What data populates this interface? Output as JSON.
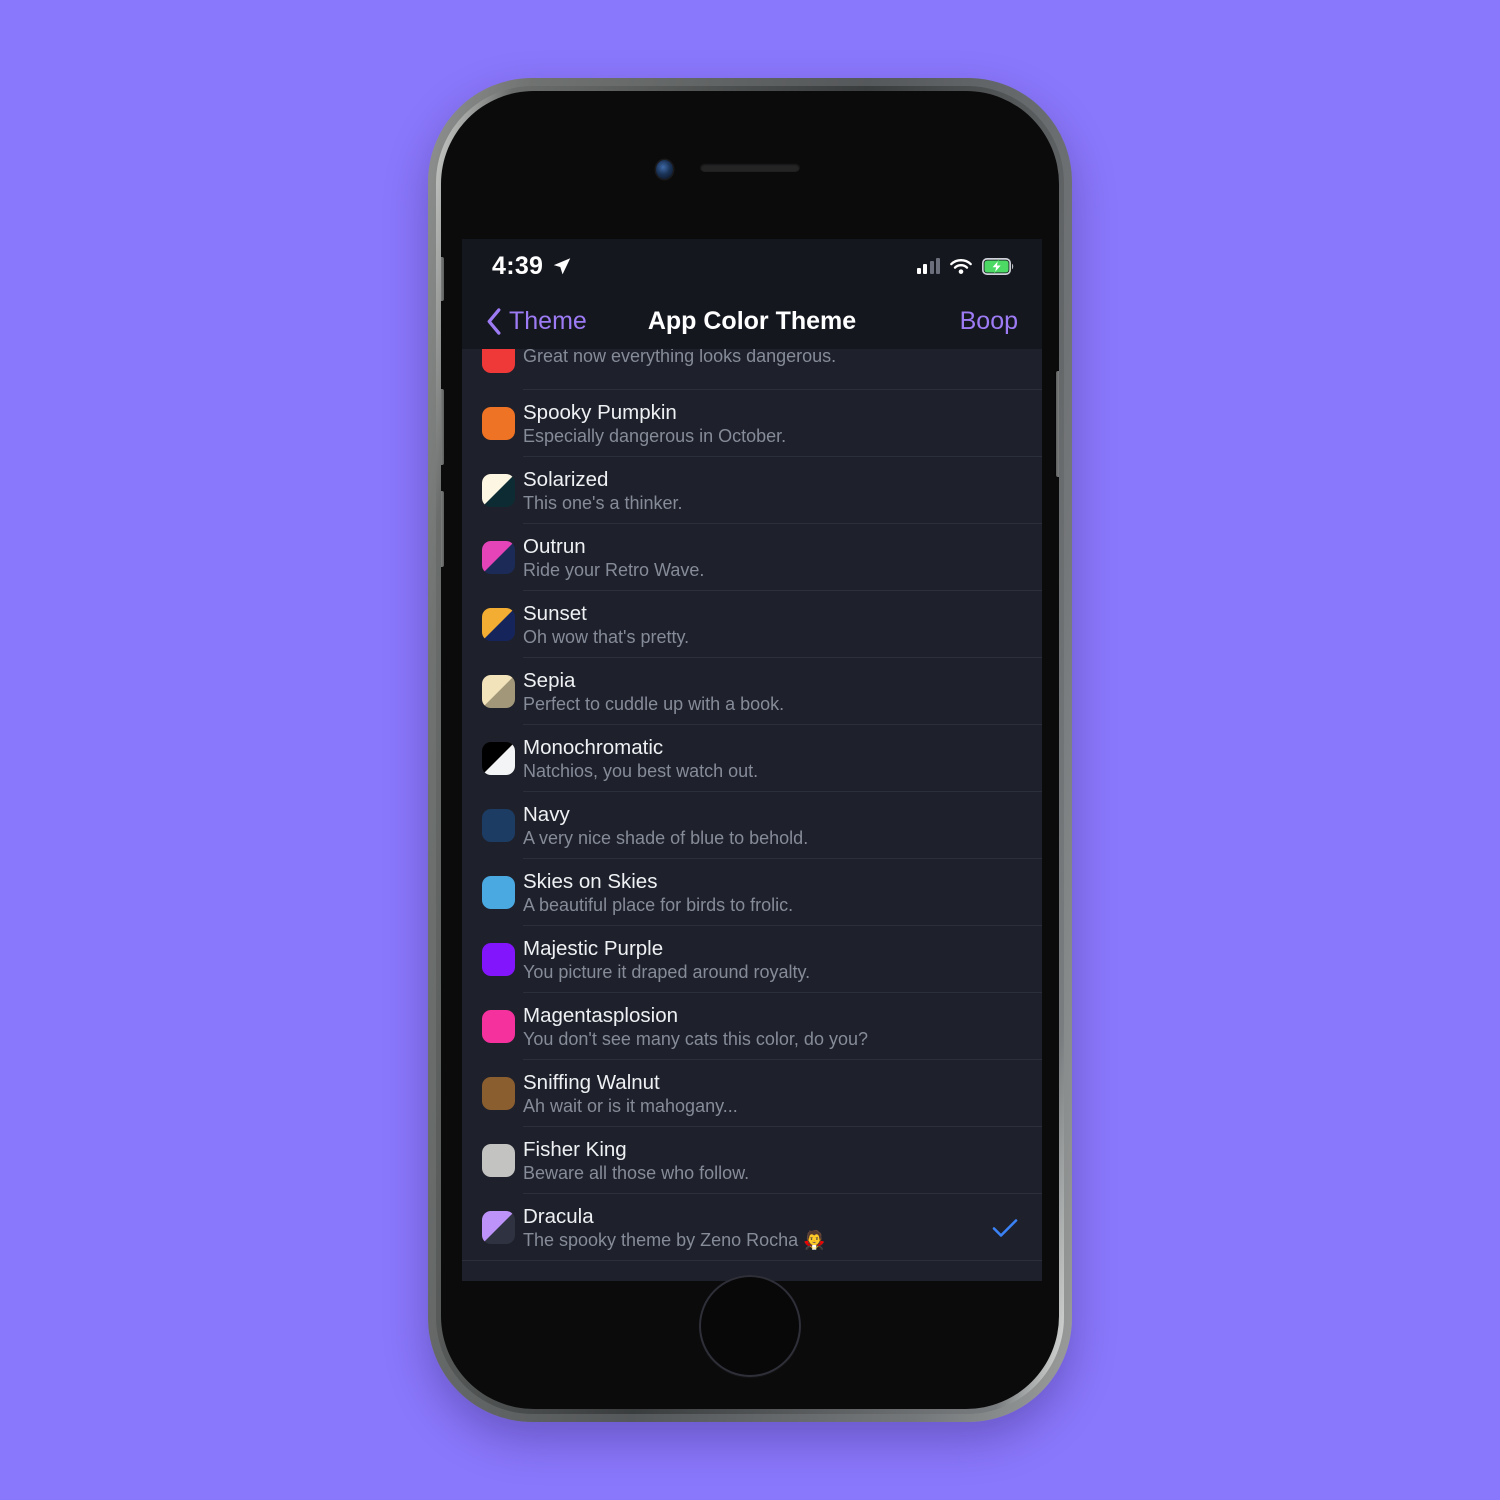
{
  "page_background": "#8a78fc",
  "status_bar": {
    "time": "4:39",
    "location_icon": "location-arrow-icon",
    "cellular_icon": "cellular-bars-icon",
    "wifi_icon": "wifi-icon",
    "battery_icon": "battery-charging-icon",
    "battery_color": "#4cd964"
  },
  "nav": {
    "back_label": "Theme",
    "back_icon": "chevron-left-icon",
    "title": "App Color Theme",
    "action_label": "Boop",
    "accent_color": "#9d7bf5"
  },
  "list": {
    "selected_theme": "Dracula",
    "check_icon": "checkmark-icon",
    "check_color": "#3b82f6",
    "rows": [
      {
        "title": "",
        "subtitle": "Great now everything looks dangerous.",
        "swatch_type": "solid",
        "swatch_colors": [
          "#ef3838"
        ],
        "selected": false,
        "clipped": true
      },
      {
        "title": "Spooky Pumpkin",
        "subtitle": "Especially dangerous in October.",
        "swatch_type": "solid",
        "swatch_colors": [
          "#ef7324"
        ],
        "selected": false
      },
      {
        "title": "Solarized",
        "subtitle": "This one's a thinker.",
        "swatch_type": "diagonal",
        "swatch_colors": [
          "#fdf6e3",
          "#0d2b32"
        ],
        "selected": false
      },
      {
        "title": "Outrun",
        "subtitle": "Ride your Retro Wave.",
        "swatch_type": "diagonal",
        "swatch_colors": [
          "#e444b8",
          "#1b2a56"
        ],
        "selected": false
      },
      {
        "title": "Sunset",
        "subtitle": "Oh wow that's pretty.",
        "swatch_type": "diagonal",
        "swatch_colors": [
          "#f4ad33",
          "#15255c"
        ],
        "selected": false
      },
      {
        "title": "Sepia",
        "subtitle": "Perfect to cuddle up with a book.",
        "swatch_type": "diagonal",
        "swatch_colors": [
          "#f3e3bb",
          "#a29879"
        ],
        "selected": false
      },
      {
        "title": "Monochromatic",
        "subtitle": "Natchios, you best watch out.",
        "swatch_type": "diagonal",
        "swatch_colors": [
          "#000000",
          "#f3f4f5"
        ],
        "selected": false
      },
      {
        "title": "Navy",
        "subtitle": "A very nice shade of blue to behold.",
        "swatch_type": "solid",
        "swatch_colors": [
          "#1c3c63"
        ],
        "selected": false
      },
      {
        "title": "Skies on Skies",
        "subtitle": "A beautiful place for birds to frolic.",
        "swatch_type": "solid",
        "swatch_colors": [
          "#4ba9e2"
        ],
        "selected": false
      },
      {
        "title": "Majestic Purple",
        "subtitle": "You picture it draped around royalty.",
        "swatch_type": "solid",
        "swatch_colors": [
          "#8215fb"
        ],
        "selected": false
      },
      {
        "title": "Magentasplosion",
        "subtitle": "You don't see many cats this color, do you?",
        "swatch_type": "solid",
        "swatch_colors": [
          "#f5319d"
        ],
        "selected": false
      },
      {
        "title": "Sniffing Walnut",
        "subtitle": "Ah wait or is it mahogany...",
        "swatch_type": "solid",
        "swatch_colors": [
          "#8b5e2f"
        ],
        "selected": false
      },
      {
        "title": "Fisher King",
        "subtitle": "Beware all those who follow.",
        "swatch_type": "solid",
        "swatch_colors": [
          "#c3c4c2"
        ],
        "selected": false
      },
      {
        "title": "Dracula",
        "subtitle": "The spooky theme by Zeno Rocha 🧛",
        "swatch_type": "diagonal",
        "swatch_colors": [
          "#bd93f9",
          "#2f3240"
        ],
        "selected": true
      }
    ]
  }
}
